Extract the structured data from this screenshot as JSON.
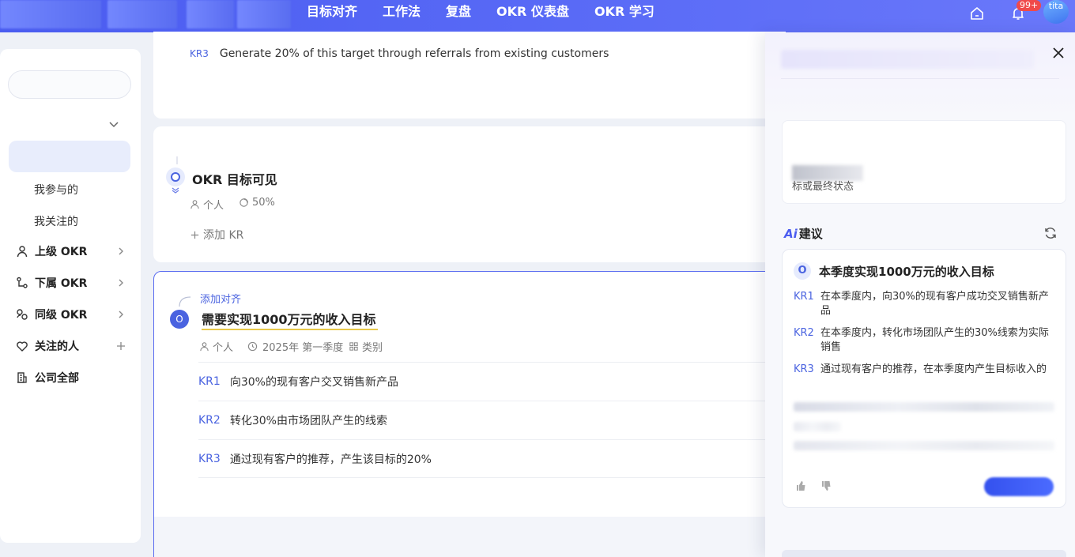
{
  "topbar": {
    "nav": [
      "目标对齐",
      "工作法",
      "复盘",
      "OKR 仪表盘",
      "OKR 学习"
    ],
    "notification_badge": "99+",
    "avatar_text": "tita"
  },
  "sidebar": {
    "sub_items": [
      "我参与的",
      "我关注的"
    ],
    "items": [
      {
        "label": "上级 OKR",
        "icon": "user-icon"
      },
      {
        "label": "下属 OKR",
        "icon": "org-tree-icon"
      },
      {
        "label": "同级 OKR",
        "icon": "peers-icon"
      },
      {
        "label": "关注的人",
        "icon": "heart-icon"
      },
      {
        "label": "公司全部",
        "icon": "building-icon"
      }
    ]
  },
  "card1": {
    "kr_tag": "KR3",
    "kr_text": "Generate 20% of this target through referrals from existing customers"
  },
  "card2": {
    "title": "OKR 目标可见",
    "owner": "个人",
    "progress": "50%",
    "add_kr": "添加 KR"
  },
  "card3": {
    "add_align": "添加对齐",
    "title": "需要实现1000万元的收入目标",
    "owner": "个人",
    "period": "2025年 第一季度",
    "category": "类别",
    "krs": [
      {
        "tag": "KR1",
        "text": "向30%的现有客户交叉销售新产品"
      },
      {
        "tag": "KR2",
        "text": "转化30%由市场团队产生的线索"
      },
      {
        "tag": "KR3",
        "text": "通过现有客户的推荐，产生该目标的20%"
      }
    ]
  },
  "drawer": {
    "top_box_text": "标或最终状态",
    "ai_logo": "Ai",
    "ai_title": "建议",
    "suggestion": {
      "o_tag": "O",
      "title": "本季度实现1000万元的收入目标",
      "krs": [
        {
          "tag": "KR1",
          "text": "在本季度内，向30%的现有客户成功交叉销售新产品"
        },
        {
          "tag": "KR2",
          "text": "在本季度内，转化市场团队产生的30%线索为实际销售"
        },
        {
          "tag": "KR3",
          "text": "通过现有客户的推荐，在本季度内产生目标收入的"
        }
      ]
    }
  },
  "colors": {
    "accent": "#4a63e0",
    "topbar": "#5b6cf7",
    "highlight": "#e8c84a"
  }
}
